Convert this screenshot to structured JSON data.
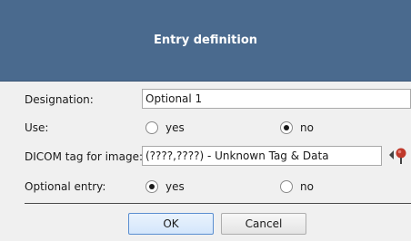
{
  "dialog": {
    "title": "Entry definition"
  },
  "form": {
    "designation": {
      "label": "Designation:",
      "value": "Optional 1"
    },
    "use": {
      "label": "Use:",
      "options": [
        "yes",
        "no"
      ],
      "selected": "no"
    },
    "dicom_tag": {
      "label": "DICOM tag for image:",
      "value": "(????,????) - Unknown Tag & Data",
      "picker_icon": "tag-picker-icon"
    },
    "optional_entry": {
      "label": "Optional entry:",
      "options": [
        "yes",
        "no"
      ],
      "selected": "yes"
    }
  },
  "buttons": {
    "ok_label": "OK",
    "cancel_label": "Cancel"
  },
  "colors": {
    "title_bar": "#4a6a8e",
    "background": "#f0f0f0"
  }
}
